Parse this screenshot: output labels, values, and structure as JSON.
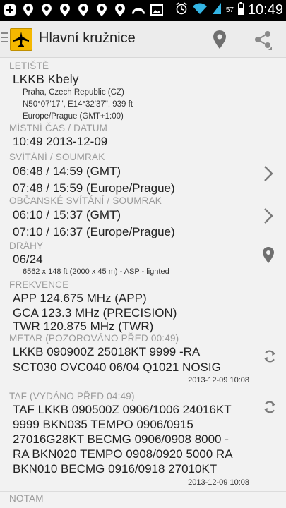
{
  "status_bar": {
    "battery": "57",
    "time": "10:49"
  },
  "action_bar": {
    "title": "Hlavní kružnice"
  },
  "airport": {
    "label": "LETIŠTĚ",
    "code_name": "LKKB Kbely",
    "location": "Praha, Czech Republic (CZ)",
    "coords": "N50°07'17\", E14°32'37\", 939 ft",
    "timezone": "Europe/Prague (GMT+1:00)"
  },
  "local_time": {
    "label": "MÍSTNÍ ČAS / DATUM",
    "value": "10:49 2013-12-09"
  },
  "sunrise": {
    "label": "SVÍTÁNÍ / SOUMRAK",
    "gmt": "06:48 / 14:59 (GMT)",
    "local": "07:48 / 15:59 (Europe/Prague)"
  },
  "civil": {
    "label": "OBČANSKÉ SVÍTÁNÍ / SOUMRAK",
    "gmt": "06:10 / 15:37 (GMT)",
    "local": "07:10 / 16:37 (Europe/Prague)"
  },
  "runways": {
    "label": "DRÁHY",
    "name": "06/24",
    "detail": "6562 x 148 ft (2000 x 45 m) - ASP - lighted"
  },
  "frequencies": {
    "label": "FREKVENCE",
    "items": [
      "APP 124.675 MHz (APP)",
      "GCA 123.3 MHz (PRECISION)",
      "TWR 120.875 MHz (TWR)"
    ]
  },
  "metar": {
    "label": "METAR (POZOROVÁNO PŘED 00:49)",
    "lines": [
      "LKKB 090900Z 25018KT 9999 -RA",
      "SCT030 OVC040 06/04 Q1021 NOSIG"
    ],
    "stamp": "2013-12-09 10:08"
  },
  "taf": {
    "label": "TAF (VYDÁNO PŘED 04:49)",
    "lines": [
      "TAF LKKB 090500Z 0906/1006 24016KT",
      "9999 BKN035 TEMPO 0906/0915",
      "27016G28KT BECMG 0906/0908 8000 -",
      "RA BKN020 TEMPO 0908/0920 5000 RA",
      "BKN010 BECMG 0916/0918 27010KT"
    ],
    "stamp": "2013-12-09 10:08"
  },
  "notam": {
    "label": "NOTAM"
  },
  "colors": {
    "status_bg": "#000000",
    "actionbar_bg": "#ececec",
    "logo": "#f5b800",
    "label_gray": "#9a9a9a",
    "icon_gray": "#777777"
  }
}
